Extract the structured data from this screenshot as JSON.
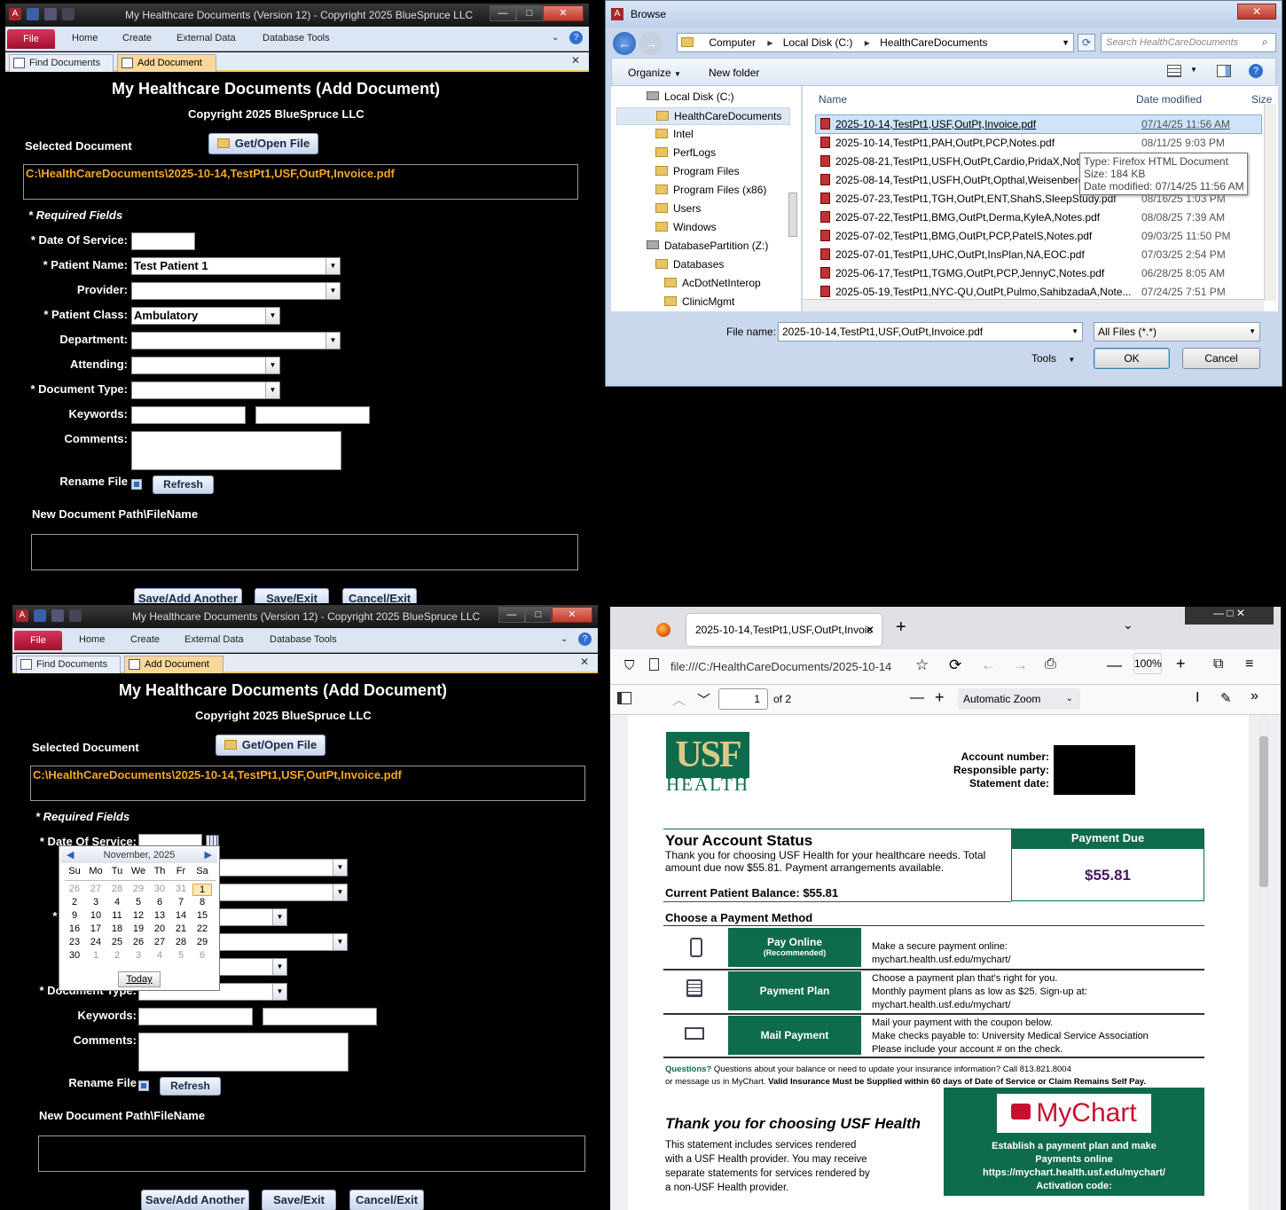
{
  "access": {
    "title": "My Healthcare Documents (Version 12) - Copyright 2025 BlueSpruce LLC",
    "ribbon": {
      "file": "File",
      "home": "Home",
      "create": "Create",
      "external": "External Data",
      "dbtools": "Database Tools"
    },
    "tabs": {
      "find": "Find Documents",
      "add": "Add Document"
    },
    "form": {
      "heading": "My Healthcare Documents  (Add Document)",
      "copyright": "Copyright 2025 BlueSpruce LLC",
      "selected_label": "Selected Document",
      "get_open": "Get/Open File",
      "selected_path": "C:\\HealthCareDocuments\\2025-10-14,TestPt1,USF,OutPt,Invoice.pdf",
      "required": "* Required Fields",
      "labels": {
        "dos": "*  Date Of Service:",
        "patient": "* Patient Name:",
        "provider": "Provider:",
        "pclass": "* Patient Class:",
        "department": "Department:",
        "attending": "Attending:",
        "doctype": "* Document Type:",
        "keywords": "Keywords:",
        "comments": "Comments:",
        "rename": "Rename File"
      },
      "values": {
        "patient": "Test Patient 1",
        "pclass": "Ambulatory"
      },
      "refresh": "Refresh",
      "newpath_label": "New Document Path\\FileName",
      "save_add": "Save/Add Another",
      "save_exit": "Save/Exit",
      "cancel_exit": "Cancel/Exit"
    }
  },
  "calendar": {
    "month": "November, 2025",
    "days": [
      "Su",
      "Mo",
      "Tu",
      "We",
      "Th",
      "Fr",
      "Sa"
    ],
    "weeks": [
      [
        "26",
        "27",
        "28",
        "29",
        "30",
        "31",
        "1"
      ],
      [
        "2",
        "3",
        "4",
        "5",
        "6",
        "7",
        "8"
      ],
      [
        "9",
        "10",
        "11",
        "12",
        "13",
        "14",
        "15"
      ],
      [
        "16",
        "17",
        "18",
        "19",
        "20",
        "21",
        "22"
      ],
      [
        "23",
        "24",
        "25",
        "26",
        "27",
        "28",
        "29"
      ],
      [
        "30",
        "1",
        "2",
        "3",
        "4",
        "5",
        "6"
      ]
    ],
    "today": "Today"
  },
  "browse": {
    "title": "Browse",
    "crumbs": [
      "Computer",
      "Local Disk (C:)",
      "HealthCareDocuments"
    ],
    "search_placeholder": "Search HealthCareDocuments",
    "organize": "Organize",
    "new_folder": "New folder",
    "tree": [
      "Local Disk (C:)",
      "HealthCareDocuments",
      "Intel",
      "PerfLogs",
      "Program Files",
      "Program Files (x86)",
      "Users",
      "Windows",
      "DatabasePartition (Z:)",
      "Databases",
      "AcDotNetInterop",
      "ClinicMgmt"
    ],
    "col_name": "Name",
    "col_date": "Date modified",
    "col_size": "Size",
    "files": [
      {
        "name": "2025-10-14,TestPt1,USF,OutPt,Invoice.pdf",
        "date": "07/14/25 11:56 AM"
      },
      {
        "name": "2025-10-14,TestPt1,PAH,OutPt,PCP,Notes.pdf",
        "date": "08/11/25 9:03 PM"
      },
      {
        "name": "2025-08-21,TestPt1,USFH,OutPt,Cardio,PridaX,Notes",
        "date": ""
      },
      {
        "name": "2025-08-14,TestPt1,USFH,OutPt,Opthal,Weisenberg",
        "date": ""
      },
      {
        "name": "2025-07-23,TestPt1,TGH,OutPt,ENT,ShahS,SleepStudy.pdf",
        "date": "08/16/25 1:03 PM"
      },
      {
        "name": "2025-07-22,TestPt1,BMG,OutPt,Derma,KyleA,Notes.pdf",
        "date": "08/08/25 7:39 AM"
      },
      {
        "name": "2025-07-02,TestPt1,BMG,OutPt,PCP,PatelS,Notes.pdf",
        "date": "09/03/25 11:50 PM"
      },
      {
        "name": "2025-07-01,TestPt1,UHC,OutPt,InsPlan,NA,EOC.pdf",
        "date": "07/03/25 2:54 PM"
      },
      {
        "name": "2025-06-17,TestPt1,TGMG,OutPt,PCP,JennyC,Notes.pdf",
        "date": "06/28/25 8:05 AM"
      },
      {
        "name": "2025-05-19,TestPt1,NYC-QU,OutPt,Pulmo,SahibzadaA,Note...",
        "date": "07/24/25 7:51 PM"
      }
    ],
    "tooltip": {
      "type": "Type: Firefox HTML Document",
      "size": "Size: 184 KB",
      "date": "Date modified: 07/14/25 11:56 AM"
    },
    "filename_label": "File name:",
    "filename": "2025-10-14,TestPt1,USF,OutPt,Invoice.pdf",
    "filter": "All Files (*.*)",
    "tools": "Tools",
    "ok": "OK",
    "cancel": "Cancel"
  },
  "firefox": {
    "tab_title": "2025-10-14,TestPt1,USF,OutPt,Invoic",
    "url": "file:///C:/HealthCareDocuments/2025-10-14",
    "zoom": "100%",
    "page": "1",
    "of_pages": "of 2",
    "zoom_select": "Automatic Zoom"
  },
  "pdf": {
    "logo_top": "USF",
    "logo_bottom": "HEALTH",
    "acct_labels": [
      "Account number:",
      "Responsible party:",
      "Statement date:"
    ],
    "status_title": "Your Account Status",
    "status_text1": "Thank you for choosing USF Health for your healthcare needs. Total",
    "status_text2": "amount due now $55.81. Payment arrangements available.",
    "balance": "Current Patient Balance:  $55.81",
    "payment_due_label": "Payment Due",
    "payment_due": "$55.81",
    "choose": "Choose a Payment Method",
    "pay_online": "Pay Online",
    "recommended": "(Recommended)",
    "pay_online_t1": "Make a secure payment online:",
    "pay_online_t2": "mychart.health.usf.edu/mychart/",
    "plan": "Payment Plan",
    "plan_t1": "Choose a payment plan that's right for you.",
    "plan_t2": "Monthly payment plans as low as $25.   Sign-up at:",
    "plan_t3": "mychart.health.usf.edu/mychart/",
    "mail": "Mail Payment",
    "mail_t1": "Mail your payment with the coupon below.",
    "mail_t2": "Make checks payable to:   University Medical Service  Association",
    "mail_t3": "Please include your account # on the check.",
    "questions_label": "Questions?",
    "questions": "Questions about your balance or need to update your insurance information?   Call 813.821.8004",
    "questions2": "or message us in MyChart.",
    "questions_bold": "Valid Insurance Must be Supplied within 60 days of Date of Service or Claim Remains Self Pay.",
    "thanks": "Thank you for choosing USF Health",
    "thanks_t1": "This statement includes services rendered",
    "thanks_t2": "with a USF Health provider.  You may receive",
    "thanks_t3": "separate statements for services rendered by",
    "thanks_t4": "a non-USF Health provider.",
    "mychart": "MyChart",
    "mychart_t1": "Establish a payment plan and make",
    "mychart_t2": "Payments online",
    "mychart_t3": "https://mychart.health.usf.edu/mychart/",
    "mychart_t4": "Activation code:"
  }
}
